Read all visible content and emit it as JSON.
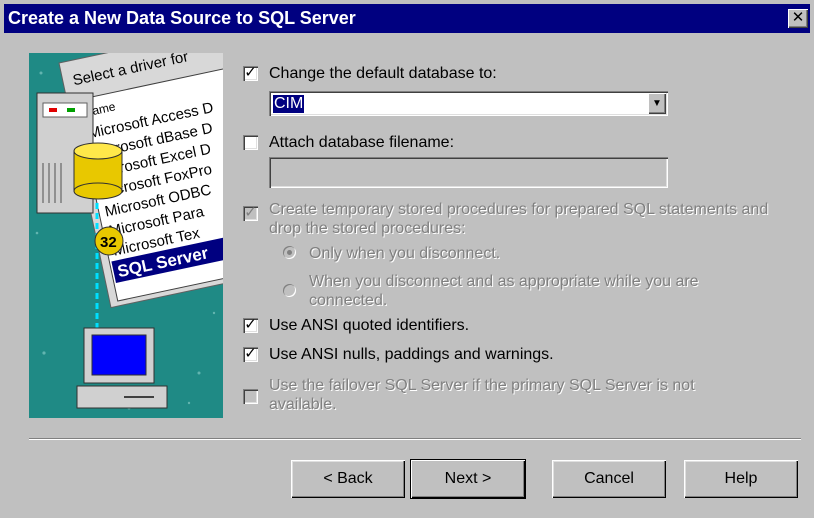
{
  "window": {
    "title": "Create a New Data Source to SQL Server",
    "close_glyph": "✕"
  },
  "illustration": {
    "list_header": "Select a driver for",
    "column_label": "Name",
    "items": [
      "Microsoft Access D",
      "Microsoft dBase D",
      "Microsoft Excel D",
      "Microsoft FoxPro",
      "Microsoft ODBC",
      "Microsoft Para",
      "Microsoft Tex",
      "SQL Server"
    ],
    "badge": "32",
    "icons": [
      "server-tower-icon",
      "database-cylinder-icon",
      "computer-icon"
    ]
  },
  "options": {
    "change_db": {
      "label": "Change the default database to:",
      "checked": true
    },
    "database_combo": {
      "value": "CIM"
    },
    "attach_db": {
      "label": "Attach database filename:",
      "checked": false
    },
    "attach_filename": {
      "value": ""
    },
    "temp_procs": {
      "label": "Create temporary stored procedures for prepared SQL statements and drop the stored procedures:",
      "checked": true,
      "disabled": true
    },
    "radio_disconnect": {
      "label": "Only when you disconnect.",
      "selected": true
    },
    "radio_appropriate": {
      "label": "When you disconnect and as appropriate while you are connected.",
      "selected": false
    },
    "ansi_quoted": {
      "label": "Use ANSI quoted identifiers.",
      "checked": true
    },
    "ansi_nulls": {
      "label": "Use ANSI nulls, paddings and warnings.",
      "checked": true
    },
    "failover": {
      "label": "Use the failover SQL Server if the primary SQL Server is not available.",
      "checked": false,
      "disabled": true
    }
  },
  "buttons": {
    "back": "< Back",
    "next": "Next >",
    "cancel": "Cancel",
    "help": "Help"
  },
  "colors": {
    "titlebar": "#000080",
    "dialog_bg": "#c0c0c0",
    "selection": "#000080"
  }
}
